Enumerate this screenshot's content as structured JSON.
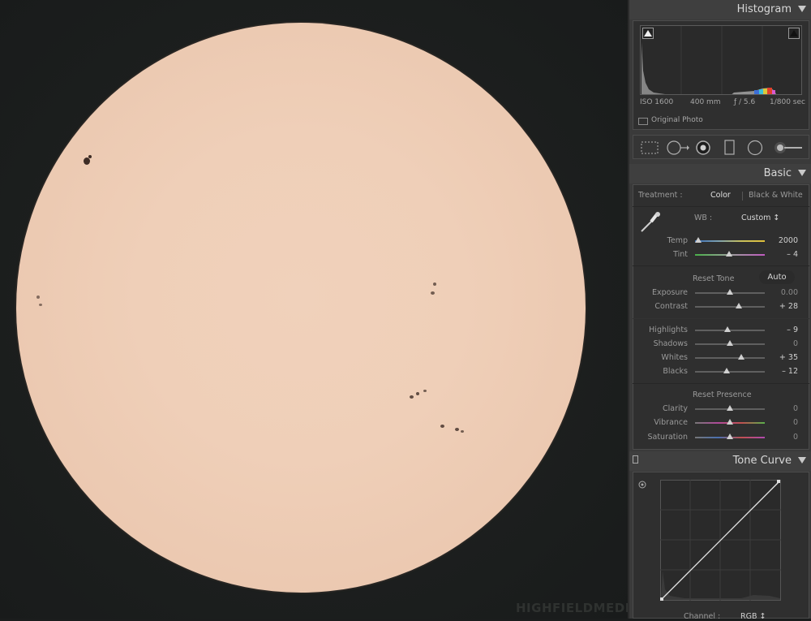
{
  "watermark": "HIGHFIELDMEDIA.COM",
  "histogram": {
    "title": "Histogram",
    "iso": "ISO 1600",
    "focal": "400 mm",
    "aperture": "ƒ / 5.6",
    "shutter": "1/800 sec",
    "original_photo": "Original Photo"
  },
  "tools": [
    "crop-overlay-icon",
    "spot-removal-icon",
    "red-eye-icon",
    "graduated-filter-icon",
    "radial-filter-icon",
    "adjustment-brush-icon"
  ],
  "basic": {
    "title": "Basic",
    "treatment_label": "Treatment :",
    "treatment_color": "Color",
    "treatment_bw": "Black & White",
    "wb_label": "WB :",
    "wb_value": "Custom ↕",
    "temp": {
      "label": "Temp",
      "value": "2000",
      "level": 0.05
    },
    "tint": {
      "label": "Tint",
      "value": "– 4",
      "level": 0.49
    },
    "reset_tone": "Reset Tone",
    "auto": "Auto",
    "exposure": {
      "label": "Exposure",
      "value": "0.00",
      "level": 0.5
    },
    "contrast": {
      "label": "Contrast",
      "value": "+ 28",
      "level": 0.63
    },
    "highlights": {
      "label": "Highlights",
      "value": "– 9",
      "level": 0.46
    },
    "shadows": {
      "label": "Shadows",
      "value": "0",
      "level": 0.5
    },
    "whites": {
      "label": "Whites",
      "value": "+ 35",
      "level": 0.66
    },
    "blacks": {
      "label": "Blacks",
      "value": "– 12",
      "level": 0.45
    },
    "reset_presence": "Reset Presence",
    "clarity": {
      "label": "Clarity",
      "value": "0",
      "level": 0.5
    },
    "vibrance": {
      "label": "Vibrance",
      "value": "0",
      "level": 0.5
    },
    "saturation": {
      "label": "Saturation",
      "value": "0",
      "level": 0.5
    }
  },
  "tone_curve": {
    "title": "Tone Curve",
    "channel_label": "Channel :",
    "channel_value": "RGB ↕"
  }
}
